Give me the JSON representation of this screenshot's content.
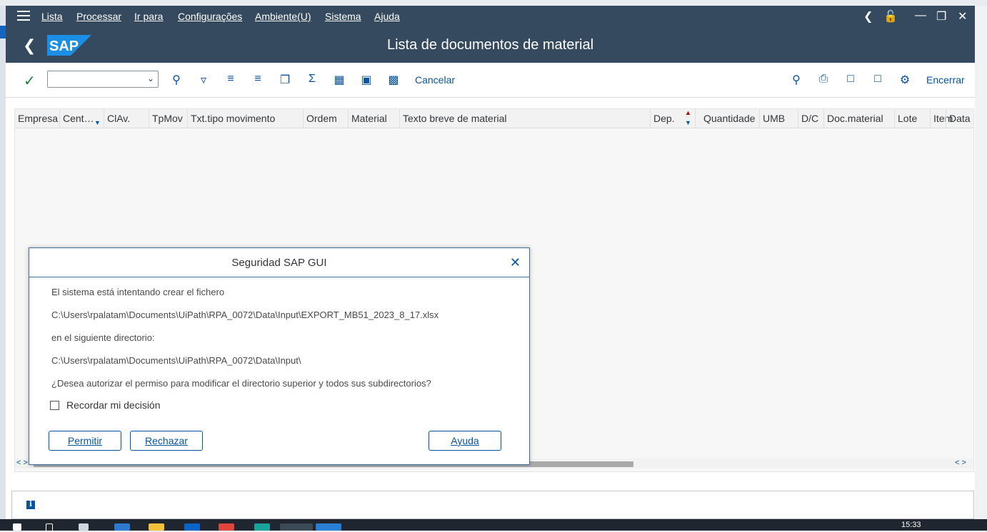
{
  "menu": {
    "items": [
      "Lista",
      "Processar",
      "Ir para",
      "Configurações",
      "Ambiente(U)",
      "Sistema",
      "Ajuda"
    ]
  },
  "title": "Lista de documentos de material",
  "logo_text": "SAP",
  "toolbar": {
    "cancel_label": "Cancelar",
    "exit_label": "Encerrar",
    "combo_value": ""
  },
  "grid": {
    "columns": [
      "Empresa",
      "Cent…",
      "ClAv.",
      "TpMov",
      "Txt.tipo movimento",
      "Ordem",
      "Material",
      "Texto breve de material",
      "Dep.",
      "Quantidade",
      "UMB",
      "D/C",
      "Doc.material",
      "Lote",
      "Item",
      "Data"
    ]
  },
  "dialog": {
    "title": "Seguridad SAP GUI",
    "lines": [
      "El sistema está intentando crear el fichero",
      "C:\\Users\\rpalatam\\Documents\\UiPath\\RPA_0072\\Data\\Input\\EXPORT_MB51_2023_8_17.xlsx",
      "en el siguiente directorio:",
      "C:\\Users\\rpalatam\\Documents\\UiPath\\RPA_0072\\Data\\Input\\",
      "¿Desea autorizar el permiso para modificar el directorio superior y todos sus subdirectorios?"
    ],
    "checkbox_label": "Recordar mi decisión",
    "buttons": {
      "allow": "Permitir",
      "reject": "Rechazar",
      "help": "Ayuda"
    }
  },
  "taskbar": {
    "clock": "15:33"
  },
  "colors": {
    "shell": "#354a5f",
    "accent": "#0854a0",
    "ok": "#107e3e"
  }
}
